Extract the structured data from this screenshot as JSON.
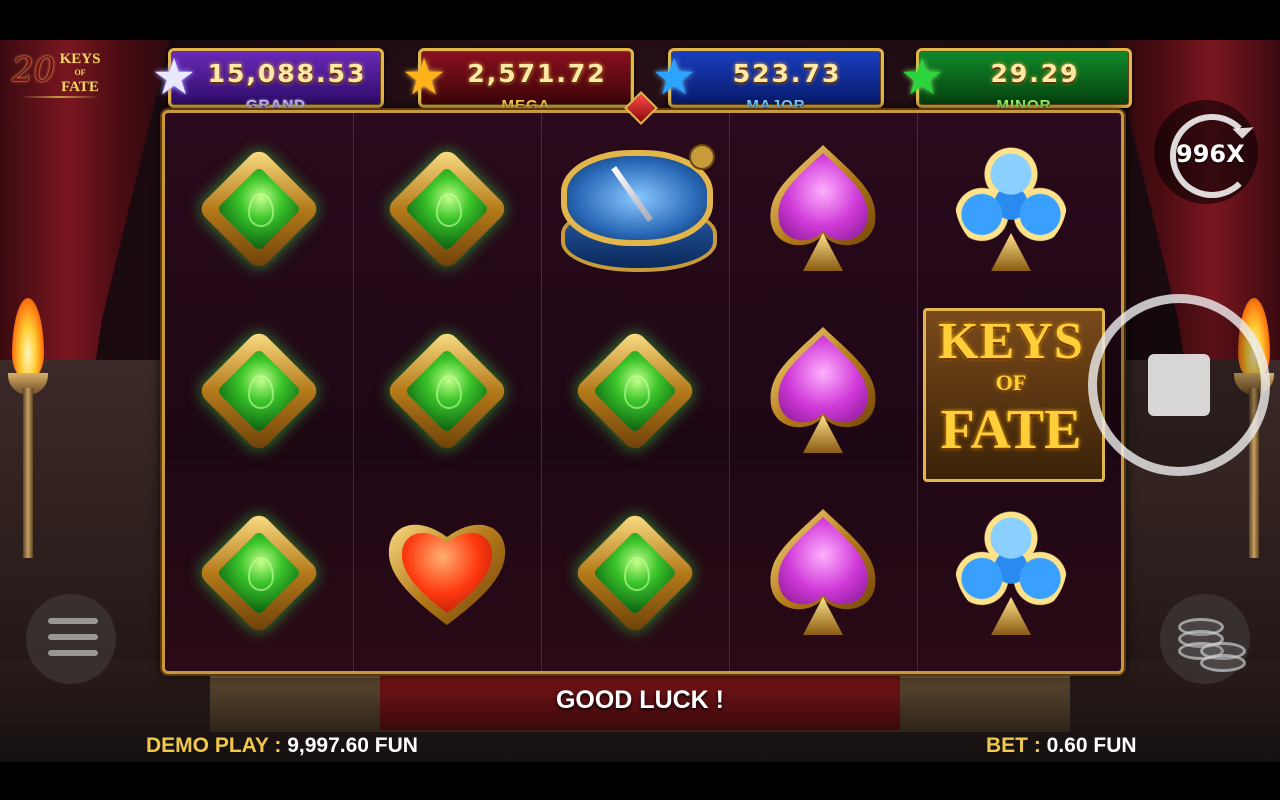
{
  "game": {
    "logo_number": "20",
    "logo_word_1": "KEYS",
    "logo_word_2": "OF",
    "logo_word_3": "FATE"
  },
  "jackpots": [
    {
      "name": "GRAND",
      "amount": "15,088.53",
      "color": "#6a2ab8"
    },
    {
      "name": "MEGA",
      "amount": "2,571.72",
      "color": "#8a1020"
    },
    {
      "name": "MAJOR",
      "amount": "523.73",
      "color": "#1a3ec0"
    },
    {
      "name": "MINOR",
      "amount": "29.29",
      "color": "#108a2a"
    }
  ],
  "reels": [
    [
      "green-diamond",
      "green-diamond",
      "green-diamond"
    ],
    [
      "green-diamond",
      "green-diamond",
      "red-heart"
    ],
    [
      "compass",
      "green-diamond",
      "green-diamond"
    ],
    [
      "purple-spade",
      "purple-spade",
      "purple-spade"
    ],
    [
      "blue-club",
      "keys-of-fate-logo",
      "blue-club"
    ]
  ],
  "logo_symbol": {
    "line1": "KEYS",
    "line2": "OF",
    "line3": "FATE"
  },
  "autoplay": {
    "count": "996X"
  },
  "message": "GOOD LUCK !",
  "balance": {
    "label": "DEMO PLAY :",
    "value": "9,997.60 FUN"
  },
  "bet": {
    "label": "BET :",
    "value": "0.60 FUN"
  }
}
